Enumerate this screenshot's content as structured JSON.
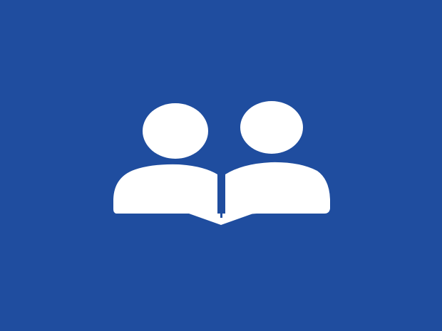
{
  "colors": {
    "background": "#1f4d9f",
    "icon": "#ffffff"
  },
  "icon": {
    "name": "two-people-open-book-icon"
  }
}
